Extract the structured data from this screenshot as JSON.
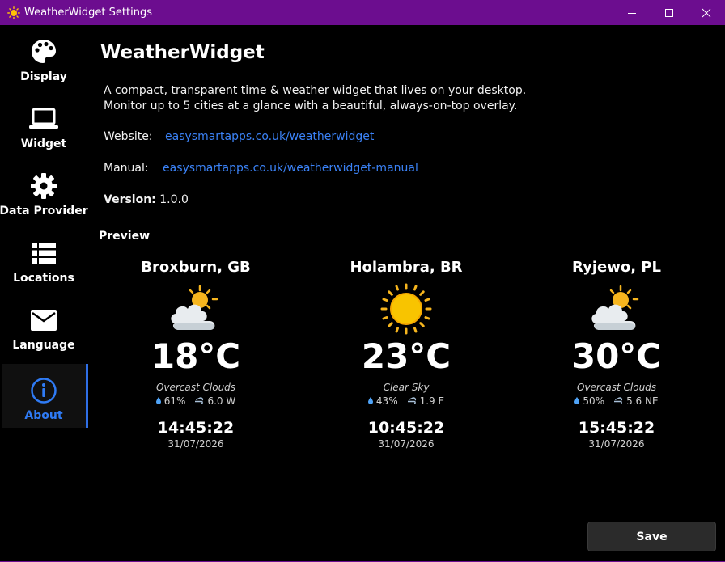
{
  "window": {
    "title": "WeatherWidget Settings"
  },
  "sidebar": {
    "items": [
      {
        "label": "Display",
        "icon": "palette-icon"
      },
      {
        "label": "Widget",
        "icon": "laptop-icon"
      },
      {
        "label": "Data Provider",
        "icon": "gear-icon"
      },
      {
        "label": "Locations",
        "icon": "list-icon"
      },
      {
        "label": "Language",
        "icon": "envelope-icon"
      },
      {
        "label": "About",
        "icon": "info-icon",
        "active": true
      }
    ],
    "accent": "#2f7bf5"
  },
  "about": {
    "heading": "WeatherWidget",
    "desc_line1": "A compact, transparent time & weather widget that lives on your desktop.",
    "desc_line2": "Monitor up to 5 cities at a glance with a beautiful, always-on-top overlay.",
    "website_label": "Website:",
    "website_link": "easysmartapps.co.uk/weatherwidget",
    "manual_label": "Manual:",
    "manual_link": "easysmartapps.co.uk/weatherwidget-manual",
    "version_label": "Version:",
    "version_value": "1.0.0",
    "link_color": "#3b82f6"
  },
  "preview": {
    "label": "Preview",
    "cards": [
      {
        "city": "Broxburn, GB",
        "icon": "partly-cloudy-icon",
        "temp": "18°C",
        "condition": "Overcast Clouds",
        "humidity": "61%",
        "wind": "6.0 W",
        "time": "14:45:22",
        "date": "31/07/2026"
      },
      {
        "city": "Holambra, BR",
        "icon": "sun-icon",
        "temp": "23°C",
        "condition": "Clear Sky",
        "humidity": "43%",
        "wind": "1.9 E",
        "time": "10:45:22",
        "date": "31/07/2026"
      },
      {
        "city": "Ryjewo, PL",
        "icon": "partly-cloudy-icon",
        "temp": "30°C",
        "condition": "Overcast Clouds",
        "humidity": "50%",
        "wind": "5.6 NE",
        "time": "15:45:22",
        "date": "31/07/2026"
      }
    ]
  },
  "footer": {
    "save_label": "Save"
  },
  "colors": {
    "titlebar": "#6c0d8f",
    "background": "#000000"
  }
}
